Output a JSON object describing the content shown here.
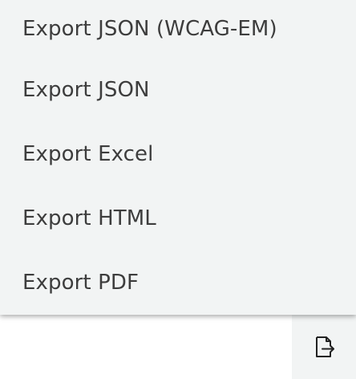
{
  "menu": {
    "items": [
      {
        "label": "Export JSON (WCAG-EM)"
      },
      {
        "label": "Export JSON"
      },
      {
        "label": "Export Excel"
      },
      {
        "label": "Export HTML"
      },
      {
        "label": "Export PDF"
      }
    ]
  },
  "toolbar": {
    "export_icon": "export-icon"
  },
  "colors": {
    "menu_background": "#f2f4f4",
    "text": "#3d3d3d",
    "page_background": "#ffffff"
  }
}
